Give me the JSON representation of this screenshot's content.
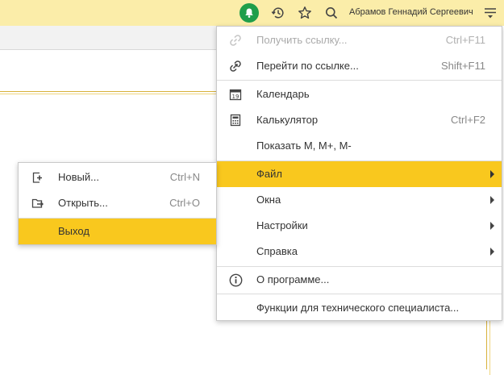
{
  "topbar": {
    "user_name": "Абрамов Геннадий Сергеевич",
    "icons": [
      "notification-bell-icon",
      "history-icon",
      "favorites-star-icon",
      "search-icon",
      "main-menu-icon"
    ],
    "notify_color": "#1f9e4a",
    "background": "#fbeda9"
  },
  "main_menu": {
    "items": [
      {
        "label": "Получить ссылку...",
        "shortcut": "Ctrl+F11",
        "icon": "link-icon",
        "disabled": true
      },
      {
        "label": "Перейти по ссылке...",
        "shortcut": "Shift+F11",
        "icon": "goto-link-icon"
      },
      {
        "label": "Календарь",
        "shortcut": "",
        "icon": "calendar-icon",
        "icon_text": "19"
      },
      {
        "label": "Калькулятор",
        "shortcut": "Ctrl+F2",
        "icon": "calculator-icon"
      },
      {
        "label": "Показать М, М+, М-",
        "shortcut": ""
      },
      {
        "label": "Файл",
        "submenu": true,
        "active": true
      },
      {
        "label": "Окна",
        "submenu": true
      },
      {
        "label": "Настройки",
        "submenu": true
      },
      {
        "label": "Справка",
        "submenu": true
      },
      {
        "label": "О программе...",
        "icon": "info-icon"
      },
      {
        "label": "Функции для технического специалиста..."
      }
    ]
  },
  "file_submenu": {
    "items": [
      {
        "label": "Новый...",
        "shortcut": "Ctrl+N",
        "icon": "new-document-icon"
      },
      {
        "label": "Открыть...",
        "shortcut": "Ctrl+O",
        "icon": "open-folder-icon"
      },
      {
        "label": "Выход",
        "active": true
      }
    ]
  },
  "colors": {
    "accent": "#f9c81e",
    "separator": "#dcdcdc",
    "disabled_text": "#aaaaaa"
  }
}
